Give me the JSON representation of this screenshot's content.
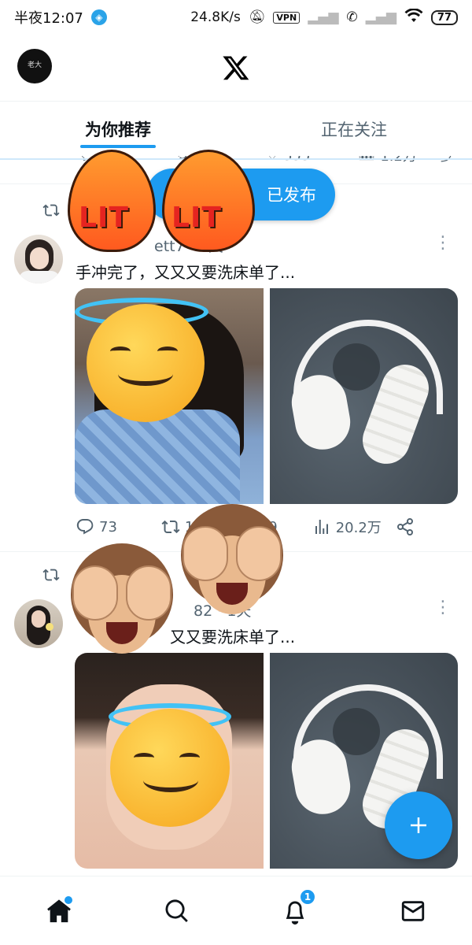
{
  "status_bar": {
    "time": "半夜12:07",
    "net_speed": "24.8K/s",
    "vpn": "VPN",
    "battery": "77"
  },
  "header": {
    "logo": "X",
    "avatar_text": "老大"
  },
  "tabs": [
    {
      "label": "为你推荐",
      "active": true
    },
    {
      "label": "正在关注",
      "active": false
    }
  ],
  "partial_row": {
    "like_count": "355",
    "views": "1.2万"
  },
  "posted_pill": {
    "label": "已发布"
  },
  "stickers": {
    "lit": "LIT"
  },
  "posts": [
    {
      "author_partial": "ett7",
      "time": "3天",
      "text": "手冲完了，又又又要洗床单了...",
      "replies": "73",
      "reposts": "1",
      "likes": "439",
      "views": "20.2万"
    },
    {
      "author_partial": "82",
      "time": "1天",
      "text": "又又要洗床单了..."
    }
  ],
  "bottom_nav": {
    "notifications_badge": "1"
  },
  "colors": {
    "accent": "#1d9bf0",
    "text": "#0f1419",
    "muted": "#536471"
  }
}
